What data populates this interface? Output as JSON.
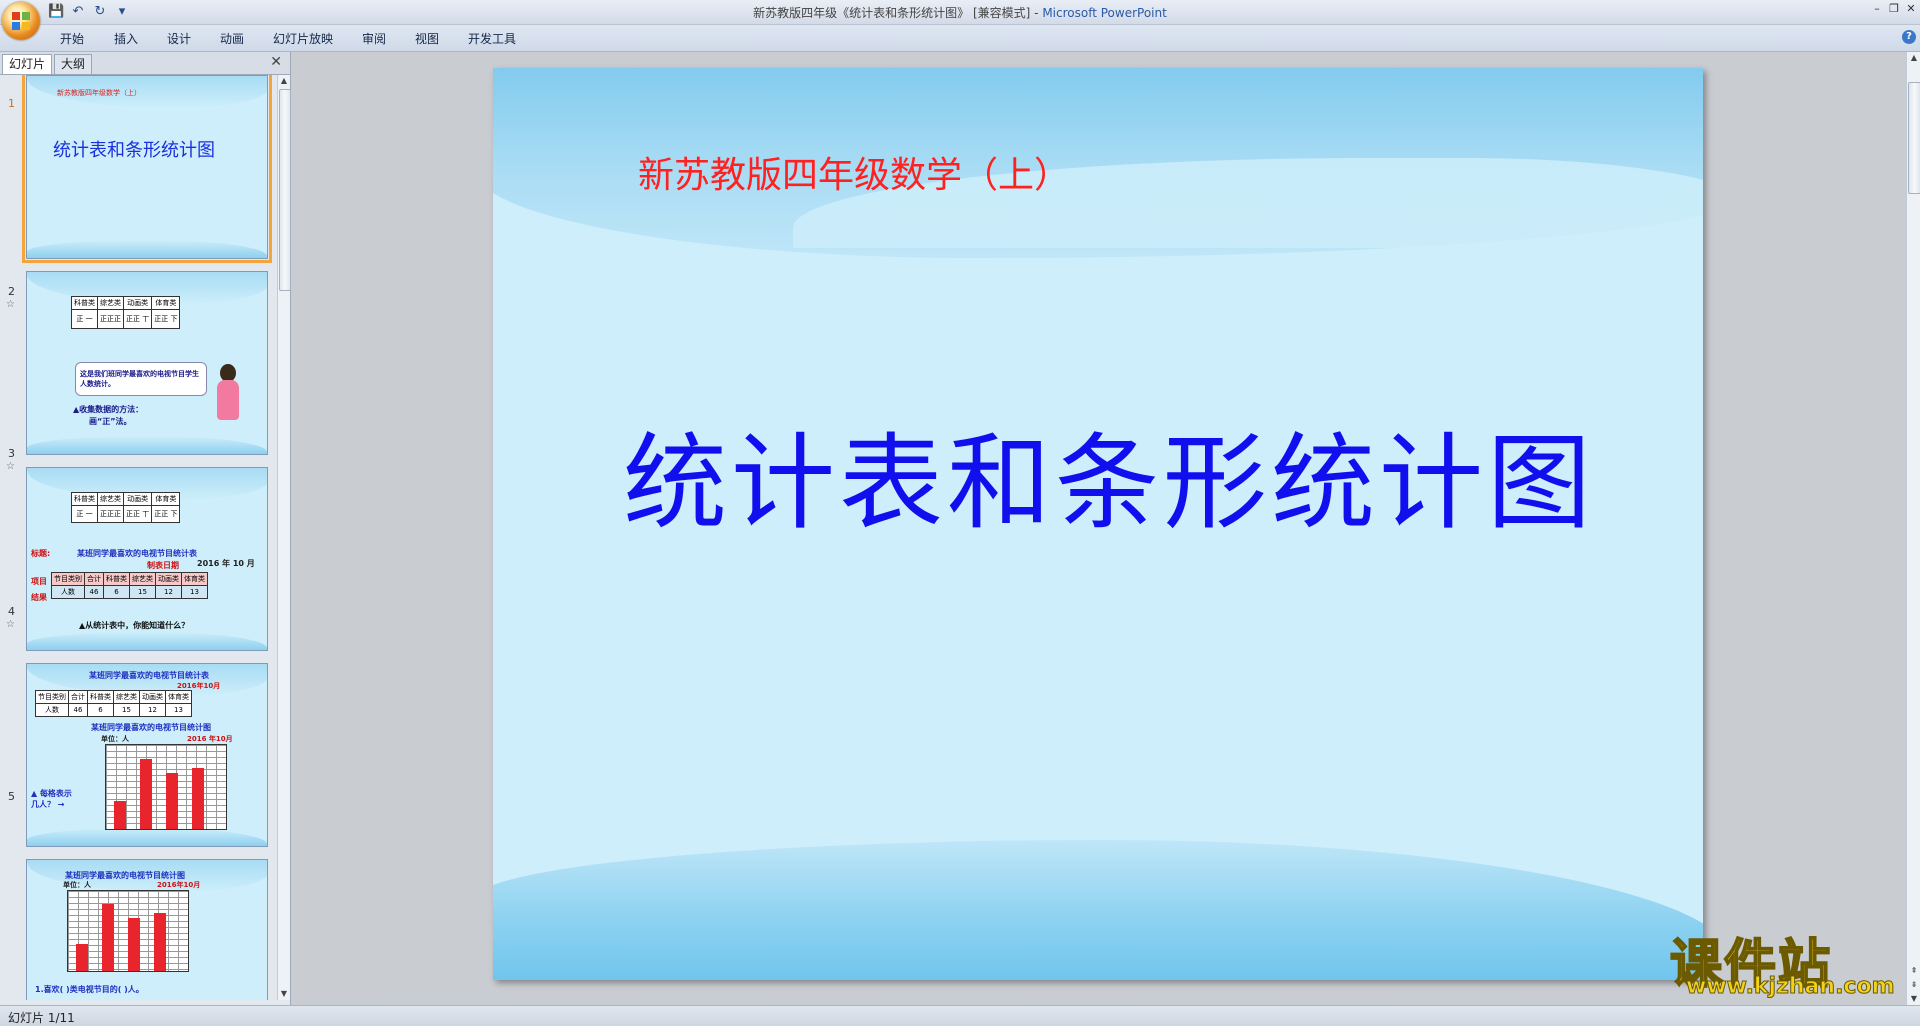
{
  "window": {
    "title_doc": "新苏教版四年级《统计表和条形统计图》 [兼容模式] - ",
    "title_app": "Microsoft PowerPoint"
  },
  "ribbon": {
    "tabs": [
      "开始",
      "插入",
      "设计",
      "动画",
      "幻灯片放映",
      "审阅",
      "视图",
      "开发工具"
    ]
  },
  "pane": {
    "tab_slides": "幻灯片",
    "tab_outline": "大纲",
    "close_label": "✕"
  },
  "thumbnails": [
    {
      "num": "1",
      "subtitle": "新苏教版四年级数学（上）",
      "title": "统计表和条形统计图"
    },
    {
      "num": "2",
      "star": "☆",
      "headers": [
        "科普类",
        "综艺类",
        "动画类",
        "体育类"
      ],
      "tallies": [
        "正 一",
        "正正正",
        "正正 丅",
        "正正 下"
      ],
      "bubble_text": "这是我们班同学最喜欢的电视节目学生人数统计。",
      "method_label": "▲收集数据的方法：",
      "method_value": "画“正”法。"
    },
    {
      "num": "3",
      "star": "☆",
      "headers": [
        "科普类",
        "综艺类",
        "动画类",
        "体育类"
      ],
      "tallies": [
        "正 一",
        "正正正",
        "正正 丅",
        "正正 下"
      ],
      "label_title": "标题:",
      "table_title": "某班同学最喜欢的电视节目统计表",
      "date_label": "制表日期",
      "date_value": "2016 年 10 月",
      "label_item": "项目",
      "label_result": "结果",
      "row_headers": [
        "节目类别",
        "合计",
        "科普类",
        "综艺类",
        "动画类",
        "体育类"
      ],
      "row_values": [
        "人数",
        "46",
        "6",
        "15",
        "12",
        "13"
      ],
      "question": "▲从统计表中，你能知道什么？"
    },
    {
      "num": "4",
      "star": "☆",
      "table_title": "某班同学最喜欢的电视节目统计表",
      "date": "2016年10月",
      "row_headers": [
        "节目类别",
        "合计",
        "科普类",
        "综艺类",
        "动画类",
        "体育类"
      ],
      "row_values": [
        "人数",
        "46",
        "6",
        "15",
        "12",
        "13"
      ],
      "chart_title": "某班同学最喜欢的电视节目统计图",
      "unit": "单位：人",
      "chart_date": "2016 年10月",
      "side_q": "▲ 每格表示几人？ →",
      "bars": [
        6,
        15,
        12,
        13
      ]
    },
    {
      "num": "5",
      "chart_title": "某班同学最喜欢的电视节目统计图",
      "unit": "单位：人",
      "chart_date": "2016年10月",
      "bars": [
        6,
        15,
        12,
        13
      ],
      "question": "1.喜欢(        )类电视节目的(      )人。"
    }
  ],
  "slide": {
    "subtitle": "新苏教版四年级数学（上）",
    "title": "统计表和条形统计图"
  },
  "watermark": {
    "main": "课件站",
    "url": "www.kjzhan.com"
  },
  "status": {
    "text": "幻灯片 1/11"
  }
}
